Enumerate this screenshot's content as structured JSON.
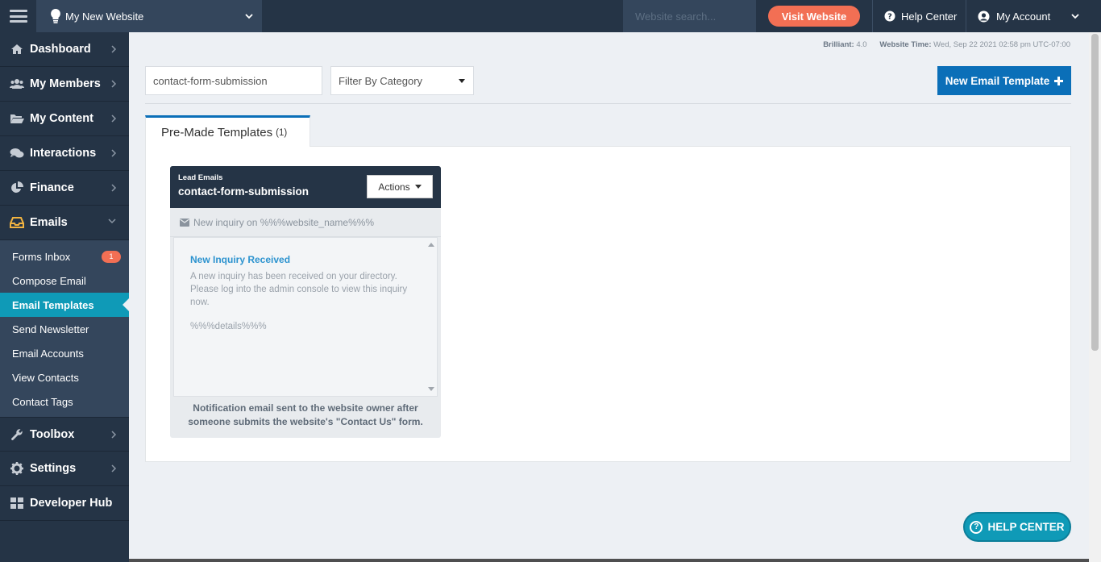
{
  "topbar": {
    "site_name": "My New Website",
    "search_placeholder": "Website search...",
    "visit_label": "Visit Website",
    "help_label": "Help Center",
    "account_label": "My Account"
  },
  "sidebar": {
    "items": [
      {
        "label": "Dashboard",
        "icon": "home-icon"
      },
      {
        "label": "My Members",
        "icon": "users-icon"
      },
      {
        "label": "My Content",
        "icon": "folder-icon"
      },
      {
        "label": "Interactions",
        "icon": "comments-icon"
      },
      {
        "label": "Finance",
        "icon": "pie-chart-icon"
      },
      {
        "label": "Emails",
        "icon": "inbox-icon"
      }
    ],
    "email_submenu": [
      {
        "label": "Forms Inbox",
        "badge": "1"
      },
      {
        "label": "Compose Email"
      },
      {
        "label": "Email Templates"
      },
      {
        "label": "Send Newsletter"
      },
      {
        "label": "Email Accounts"
      },
      {
        "label": "View Contacts"
      },
      {
        "label": "Contact Tags"
      }
    ],
    "items_after": [
      {
        "label": "Toolbox",
        "icon": "wrench-icon"
      },
      {
        "label": "Settings",
        "icon": "gear-icon"
      },
      {
        "label": "Developer Hub",
        "icon": "grid-icon"
      }
    ]
  },
  "meta": {
    "version_label": "Brilliant:",
    "version_value": "4.0",
    "time_label": "Website Time:",
    "time_value": "Wed, Sep 22 2021 02:58 pm UTC-07:00"
  },
  "toolbar": {
    "search_value": "contact-form-submission",
    "filter_label": "Filter By Category",
    "new_template_label": "New Email Template"
  },
  "tab": {
    "label": "Pre-Made Templates",
    "count": "(1)"
  },
  "template_card": {
    "category": "Lead Emails",
    "title": "contact-form-submission",
    "actions_label": "Actions",
    "subject": "New inquiry on %%%website_name%%%",
    "preview_title": "New Inquiry Received",
    "preview_body": "A new inquiry has been received on your directory. Please log into the admin console to view this inquiry now.",
    "preview_details": "%%%details%%%",
    "description": "Notification email sent to the website owner after someone submits the website's \"Contact Us\" form."
  },
  "help_button": {
    "label": "HELP CENTER"
  },
  "colors": {
    "nav_bg": "#253446",
    "accent_teal": "#0f9ab7",
    "primary_blue": "#0b6fb8",
    "visit_orange": "#f26f54"
  }
}
